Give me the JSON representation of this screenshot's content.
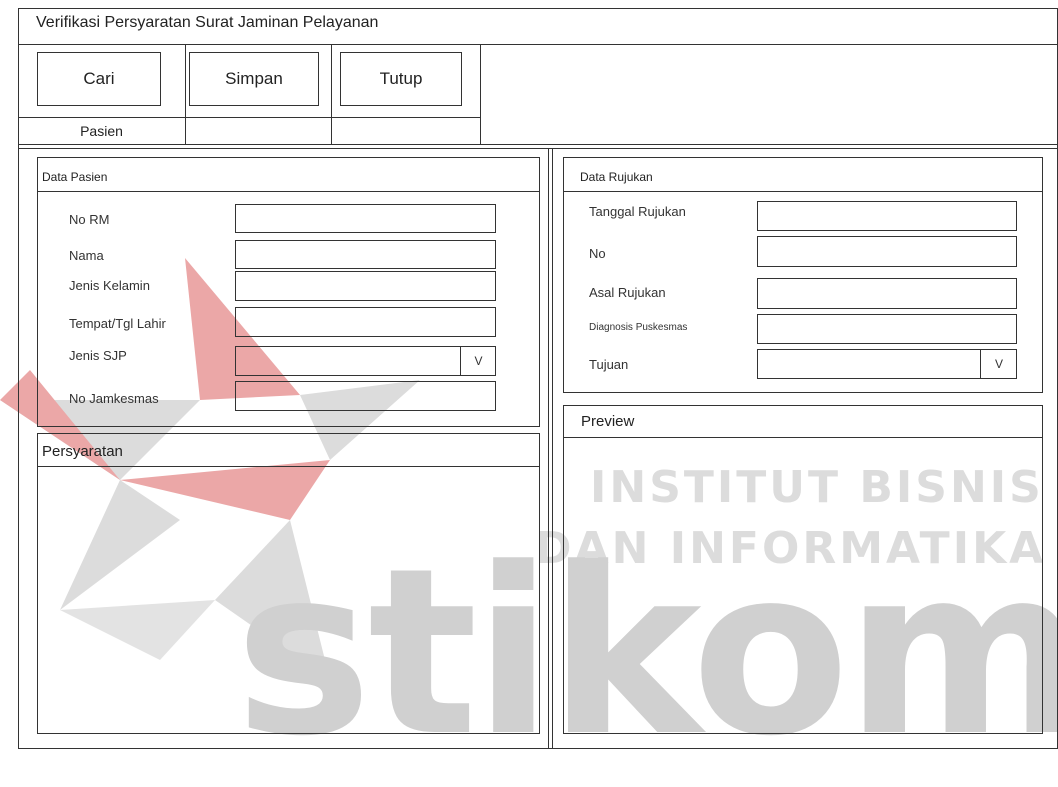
{
  "window": {
    "title": "Verifikasi Persyaratan Surat Jaminan Pelayanan"
  },
  "toolbar": {
    "search_label": "Cari",
    "save_label": "Simpan",
    "close_label": "Tutup",
    "tab_patient_label": "Pasien"
  },
  "data_pasien": {
    "title": "Data Pasien",
    "labels": {
      "no_rm": "No RM",
      "nama": "Nama",
      "jenis_kelamin": "Jenis Kelamin",
      "tempat_tgl_lahir": "Tempat/Tgl Lahir",
      "jenis_sjp": "Jenis SJP",
      "no_jamkesmas": "No Jamkesmas"
    },
    "values": {
      "no_rm": "",
      "nama": "",
      "jenis_kelamin": "",
      "tempat_tgl_lahir": "",
      "jenis_sjp": "",
      "no_jamkesmas": ""
    },
    "jenis_sjp_dropdown": "V"
  },
  "persyaratan": {
    "title": "Persyaratan"
  },
  "data_rujukan": {
    "title": "Data Rujukan",
    "labels": {
      "tanggal_rujukan": "Tanggal Rujukan",
      "no": "No",
      "asal_rujukan": "Asal Rujukan",
      "diagnosis_puskesmas": "Diagnosis Puskesmas",
      "tujuan": "Tujuan"
    },
    "values": {
      "tanggal_rujukan": "",
      "no": "",
      "asal_rujukan": "",
      "diagnosis_puskesmas": "",
      "tujuan": ""
    },
    "tujuan_dropdown": "V"
  },
  "preview": {
    "title": "Preview"
  },
  "watermark": {
    "line1": "INSTITUT BISNIS",
    "line2": "DAN INFORMATIKA",
    "brand": "stikom",
    "logo_colors": {
      "red": "#e8a0a0",
      "gray": "#c8c8c8"
    }
  }
}
